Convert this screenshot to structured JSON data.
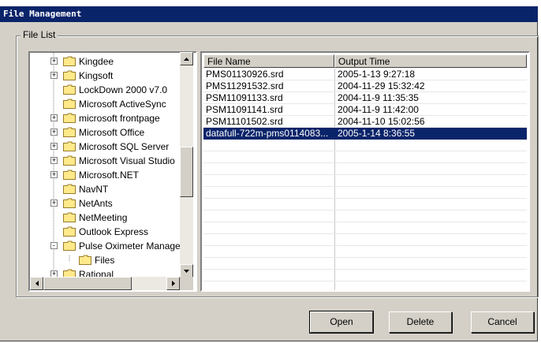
{
  "window": {
    "title": "File Management"
  },
  "group": {
    "label": "File List"
  },
  "tree": {
    "items": [
      {
        "label": "Kingdee",
        "expander": "+"
      },
      {
        "label": "Kingsoft",
        "expander": "+"
      },
      {
        "label": "LockDown 2000 v7.0",
        "expander": ""
      },
      {
        "label": "Microsoft ActiveSync",
        "expander": ""
      },
      {
        "label": "microsoft frontpage",
        "expander": "+"
      },
      {
        "label": "Microsoft Office",
        "expander": "+"
      },
      {
        "label": "Microsoft SQL Server",
        "expander": "+"
      },
      {
        "label": "Microsoft Visual Studio",
        "expander": "+"
      },
      {
        "label": "Microsoft.NET",
        "expander": "+"
      },
      {
        "label": "NavNT",
        "expander": ""
      },
      {
        "label": "NetAnts",
        "expander": "+"
      },
      {
        "label": "NetMeeting",
        "expander": ""
      },
      {
        "label": "Outlook Express",
        "expander": ""
      },
      {
        "label": "Pulse Oximeter Manager",
        "expander": "-"
      },
      {
        "label": "Files",
        "expander": "",
        "child": true
      },
      {
        "label": "Rational",
        "expander": "+"
      }
    ]
  },
  "list": {
    "columns": [
      "File Name",
      "Output Time"
    ],
    "rows": [
      [
        "PMS01130926.srd",
        "2005-1-13 9:27:18"
      ],
      [
        "PMS11291532.srd",
        "2004-11-29 15:32:42"
      ],
      [
        "PSM11091133.srd",
        "2004-11-9 11:35:35"
      ],
      [
        "PSM11091141.srd",
        "2004-11-9 11:42:00"
      ],
      [
        "PSM11101502.srd",
        "2004-11-10 15:02:56"
      ],
      [
        "datafull-722m-pms0114083...",
        "2005-1-14 8:36:55"
      ]
    ],
    "selected_index": 5
  },
  "buttons": {
    "open": "Open",
    "delete": "Delete",
    "cancel": "Cancel"
  },
  "colors": {
    "titlebar": "#0a246a",
    "face": "#d4d0c8",
    "selection": "#0a246a"
  }
}
